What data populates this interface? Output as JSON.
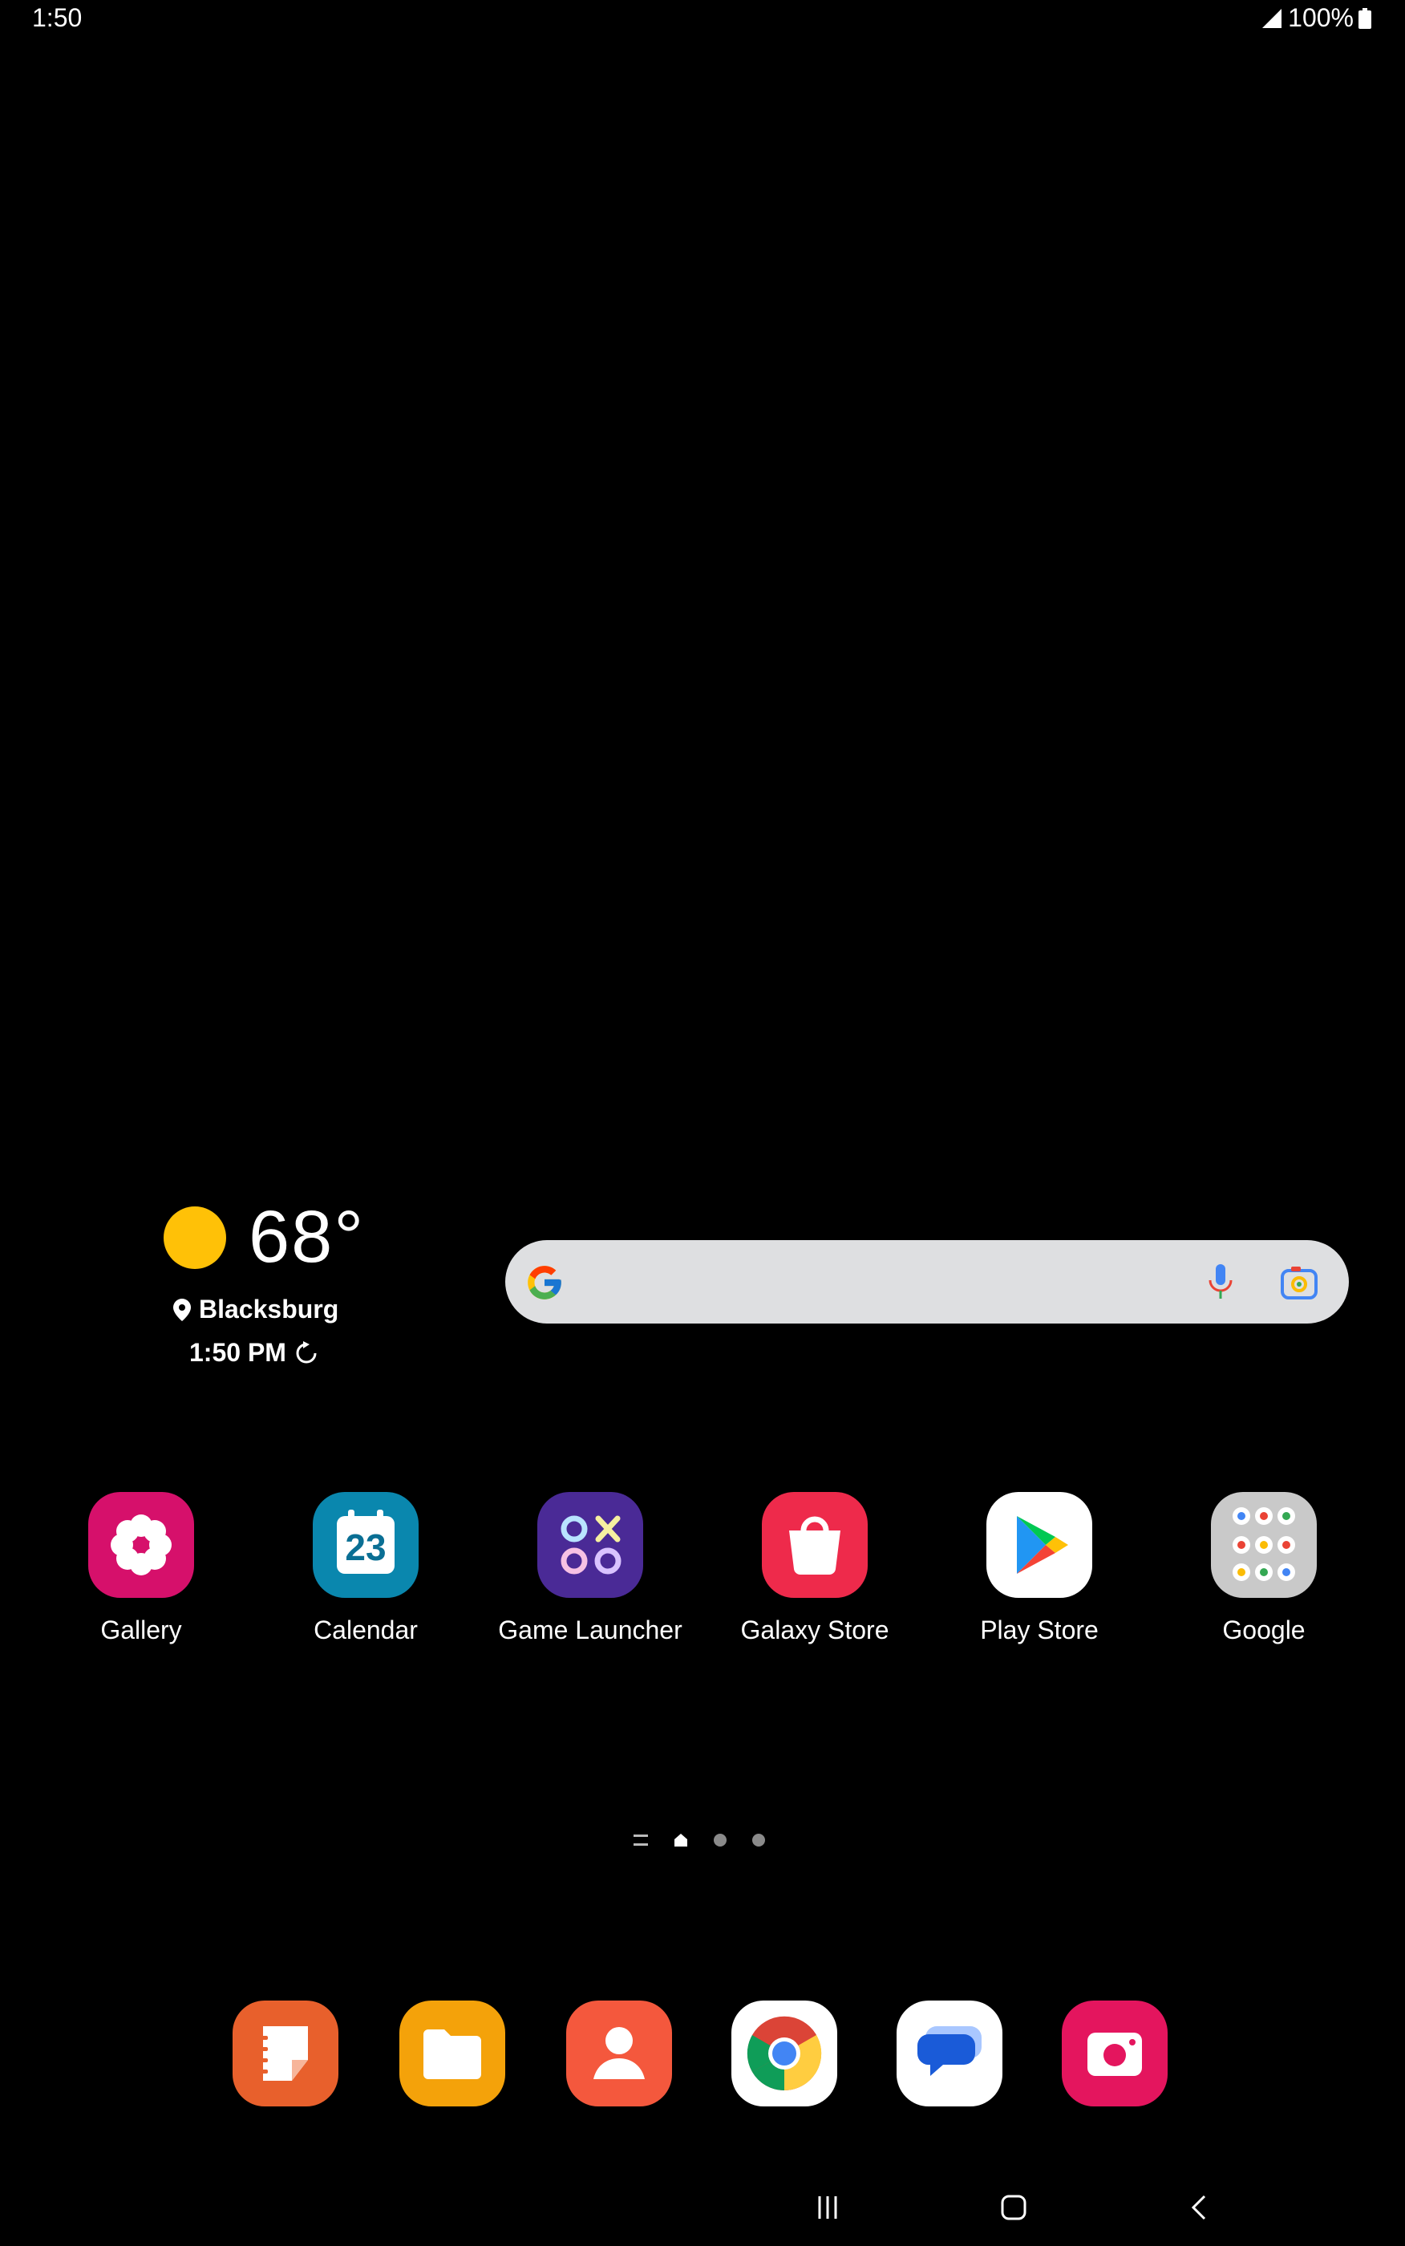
{
  "status_bar": {
    "time": "1:50",
    "battery": "100%"
  },
  "weather": {
    "temperature": "68°",
    "location": "Blacksburg",
    "updated_time": "1:50 PM",
    "icon": "sun-icon"
  },
  "search": {
    "icons": [
      "google-g-icon",
      "microphone-icon",
      "google-lens-icon"
    ]
  },
  "apps": [
    {
      "label": "Gallery",
      "icon": "gallery-icon"
    },
    {
      "label": "Calendar",
      "icon": "calendar-icon",
      "date": "23"
    },
    {
      "label": "Game Launcher",
      "icon": "game-launcher-icon"
    },
    {
      "label": "Galaxy Store",
      "icon": "galaxy-store-icon"
    },
    {
      "label": "Play Store",
      "icon": "play-store-icon"
    },
    {
      "label": "Google",
      "icon": "google-folder-icon"
    }
  ],
  "dock": [
    {
      "icon": "notes-icon"
    },
    {
      "icon": "my-files-icon"
    },
    {
      "icon": "contacts-icon"
    },
    {
      "icon": "chrome-icon"
    },
    {
      "icon": "messages-icon"
    },
    {
      "icon": "camera-icon"
    }
  ],
  "page_indicator": {
    "pages": 3,
    "current": 0
  },
  "colors": {
    "background": "#000000",
    "search_bar": "#dedfe1",
    "sun": "#FFC107"
  }
}
